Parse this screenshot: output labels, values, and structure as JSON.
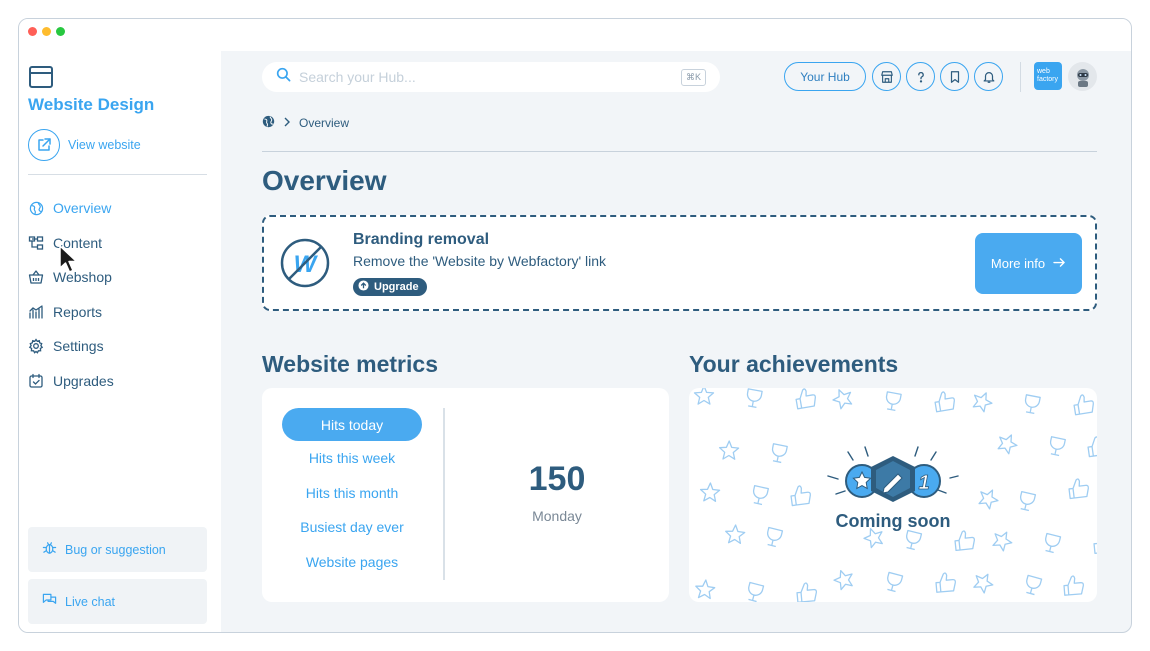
{
  "sidebar": {
    "brand": "Website Design",
    "view_website": "View website",
    "nav": [
      {
        "label": "Overview",
        "icon": "globe-icon",
        "active": true
      },
      {
        "label": "Content",
        "icon": "sitemap-icon"
      },
      {
        "label": "Webshop",
        "icon": "basket-icon"
      },
      {
        "label": "Reports",
        "icon": "chart-icon"
      },
      {
        "label": "Settings",
        "icon": "gear-icon"
      },
      {
        "label": "Upgrades",
        "icon": "calendar-check-icon"
      }
    ],
    "bug": "Bug or suggestion",
    "chat": "Live chat"
  },
  "header": {
    "search_placeholder": "Search your Hub...",
    "search_shortcut": "⌘K",
    "your_hub": "Your Hub",
    "logo_text": "web factory"
  },
  "breadcrumb": {
    "current": "Overview"
  },
  "page_title": "Overview",
  "promo": {
    "title": "Branding removal",
    "subtitle": "Remove the 'Website by Webfactory' link",
    "badge": "Upgrade",
    "button": "More info"
  },
  "metrics": {
    "title": "Website metrics",
    "tabs": [
      {
        "label": "Hits today",
        "active": true
      },
      {
        "label": "Hits this week"
      },
      {
        "label": "Hits this month"
      },
      {
        "label": "Busiest day ever"
      },
      {
        "label": "Website pages"
      }
    ],
    "value": "150",
    "day": "Monday"
  },
  "achievements": {
    "title": "Your achievements",
    "status": "Coming soon"
  },
  "colors": {
    "accent": "#3aa5f0",
    "navy": "#2e5c7e",
    "background": "#f2f5f8"
  }
}
